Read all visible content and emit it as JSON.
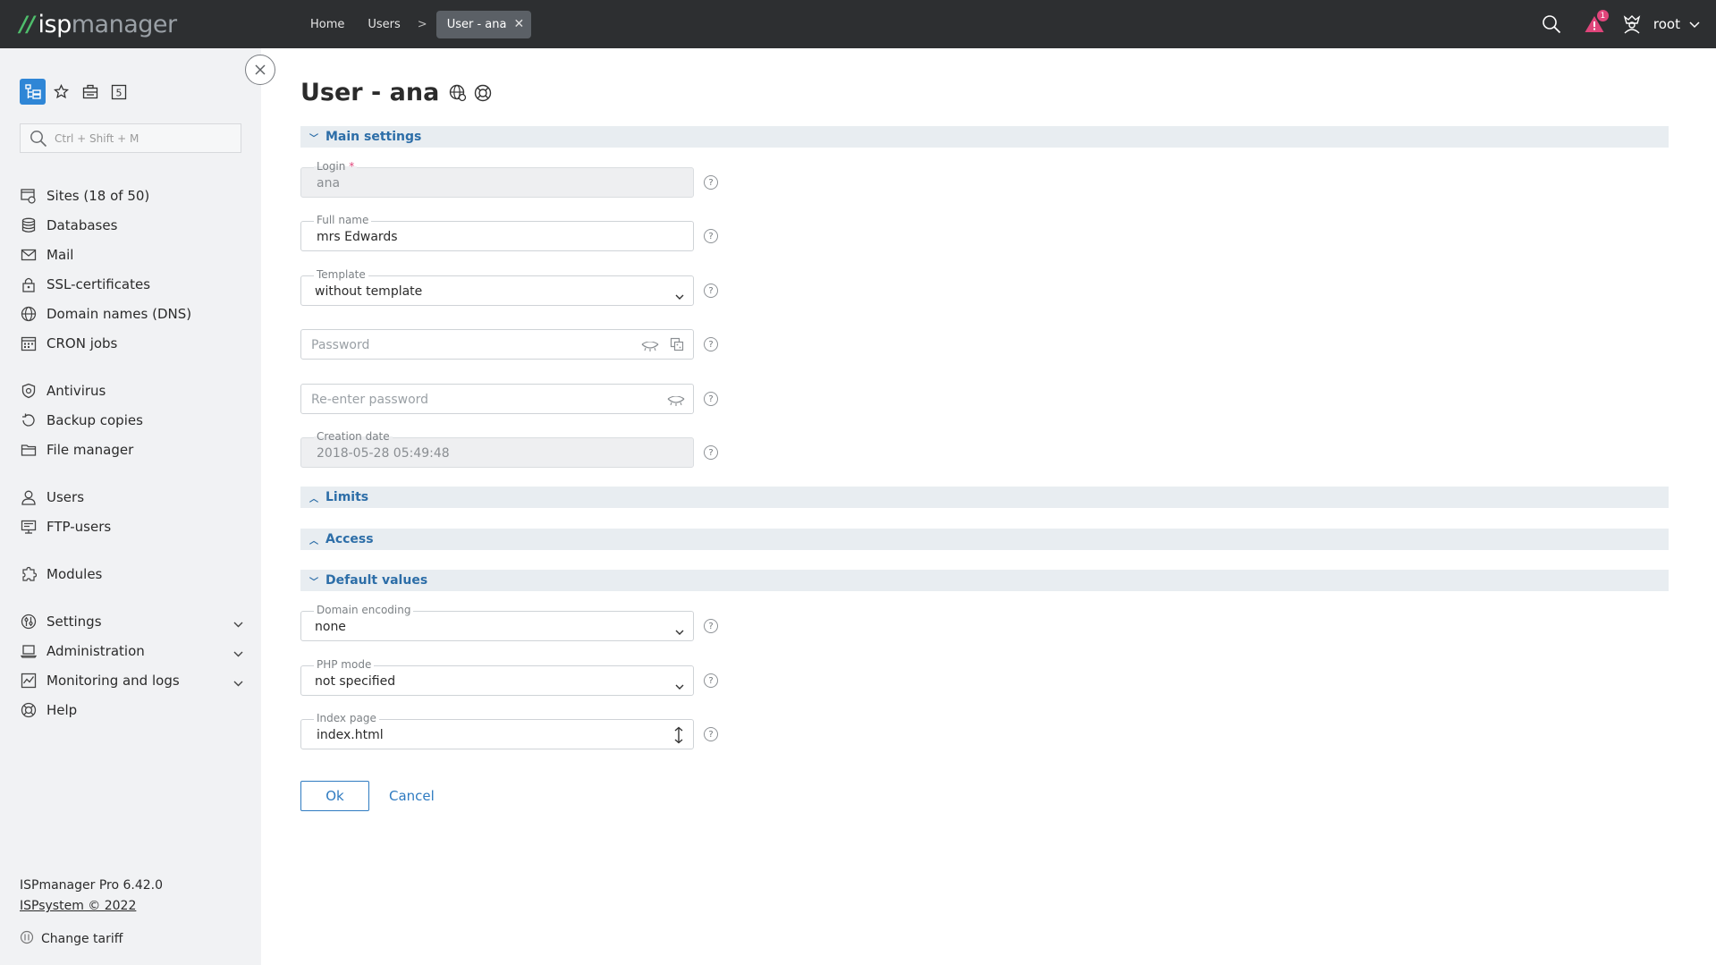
{
  "app": {
    "logo_isp": "isp",
    "logo_manager": "manager"
  },
  "breadcrumbs": {
    "home": "Home",
    "users": "Users",
    "separator": ">",
    "active": "User - ana"
  },
  "topbar": {
    "notifications_count": "1",
    "username": "root"
  },
  "sidebar": {
    "search_placeholder": "Ctrl + Shift + M",
    "items": [
      {
        "label": "Sites (18 of 50)",
        "icon": "sites-icon"
      },
      {
        "label": "Databases",
        "icon": "database-icon"
      },
      {
        "label": "Mail",
        "icon": "mail-icon"
      },
      {
        "label": "SSL-certificates",
        "icon": "lock-icon"
      },
      {
        "label": "Domain names (DNS)",
        "icon": "globe-icon"
      },
      {
        "label": "CRON jobs",
        "icon": "calendar-icon"
      },
      {
        "label": "Antivirus",
        "icon": "antivirus-icon"
      },
      {
        "label": "Backup copies",
        "icon": "backup-icon"
      },
      {
        "label": "File manager",
        "icon": "folder-icon"
      },
      {
        "label": "Users",
        "icon": "user-icon"
      },
      {
        "label": "FTP-users",
        "icon": "ftp-icon"
      },
      {
        "label": "Modules",
        "icon": "puzzle-icon"
      },
      {
        "label": "Settings",
        "icon": "settings-icon"
      },
      {
        "label": "Administration",
        "icon": "laptop-icon"
      },
      {
        "label": "Monitoring and logs",
        "icon": "chart-icon"
      },
      {
        "label": "Help",
        "icon": "help-icon"
      }
    ],
    "version": "ISPmanager Pro 6.42.0",
    "copyright": "ISPsystem © 2022",
    "change_tariff": "Change tariff"
  },
  "page": {
    "title": "User - ana"
  },
  "sections": {
    "main_settings": "Main settings",
    "limits": "Limits",
    "access": "Access",
    "default_values": "Default values"
  },
  "fields": {
    "login_label": "Login",
    "login_required": "*",
    "login_value": "ana",
    "fullname_label": "Full name",
    "fullname_value": "mrs Edwards",
    "template_label": "Template",
    "template_value": "without template",
    "password_placeholder": "Password",
    "repassword_placeholder": "Re-enter password",
    "creation_label": "Creation date",
    "creation_value": "2018-05-28 05:49:48",
    "encoding_label": "Domain encoding",
    "encoding_value": "none",
    "php_label": "PHP mode",
    "php_value": "not specified",
    "index_label": "Index page",
    "index_value": "index.html"
  },
  "buttons": {
    "ok": "Ok",
    "cancel": "Cancel"
  },
  "colors": {
    "topbar": "#2d2f31",
    "accent": "#2f7bc1",
    "sidebar": "#f1f2f4",
    "badge": "#e0457b"
  }
}
